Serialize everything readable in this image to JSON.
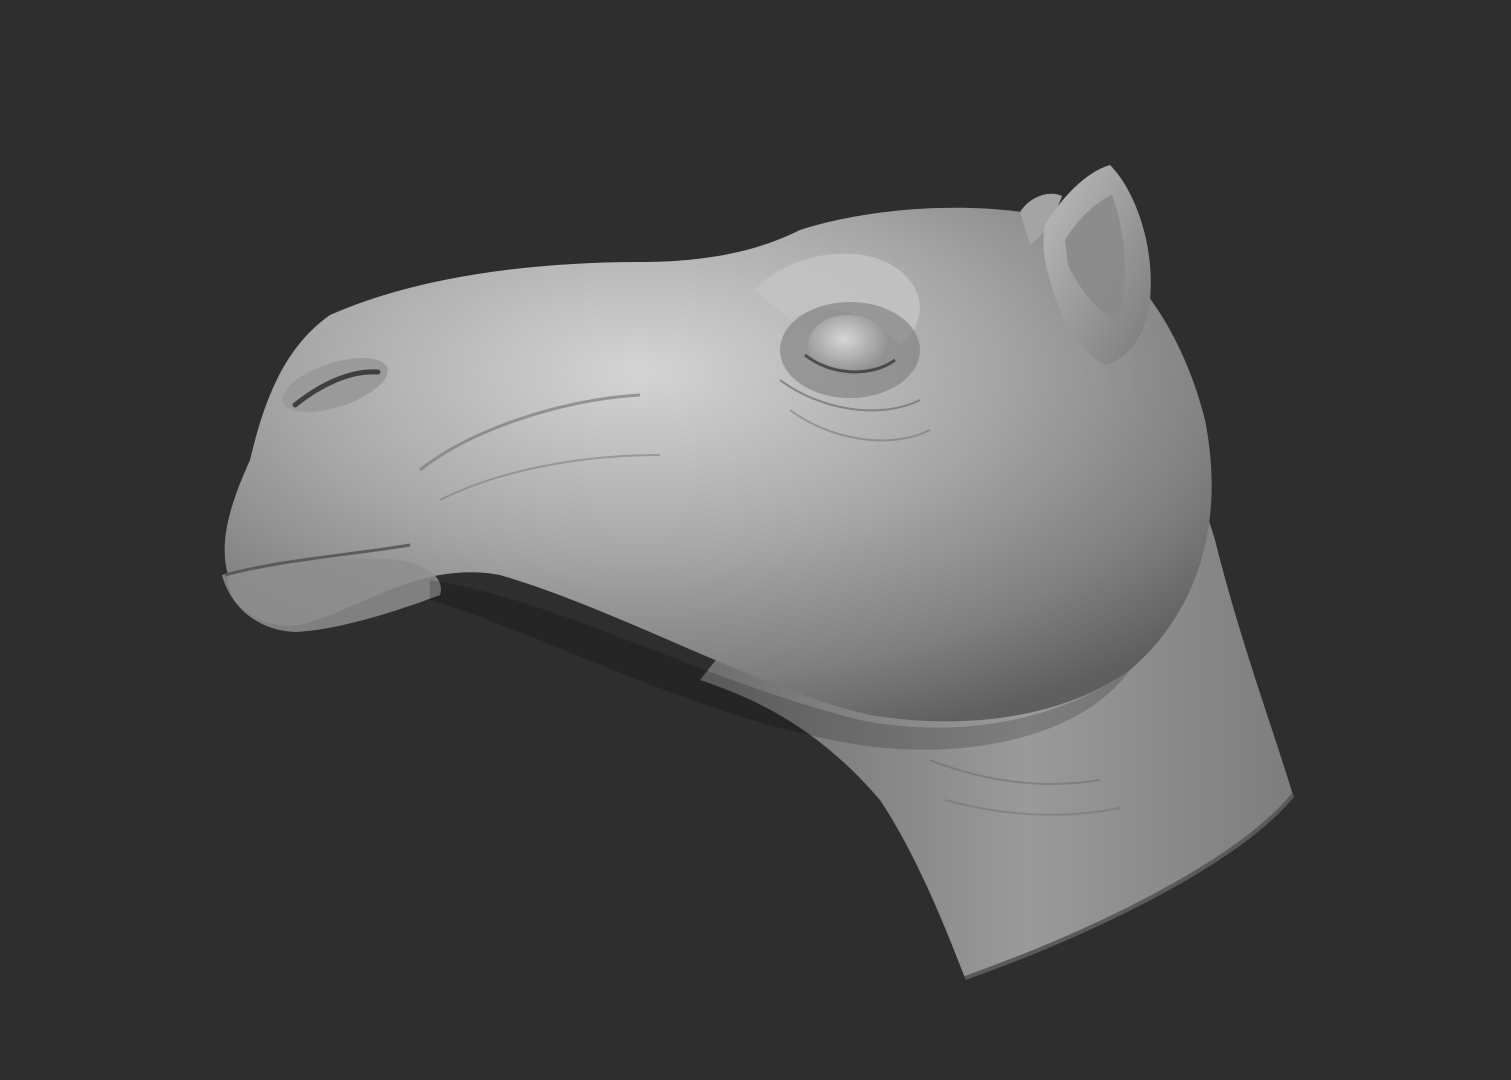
{
  "scene": {
    "background_color": "#2e2e2e",
    "subject": "camel-head-sculpt",
    "material": {
      "base": "#8c8c8c",
      "highlight": "#d2d2d2",
      "shadow": "#3c3c3c"
    }
  }
}
